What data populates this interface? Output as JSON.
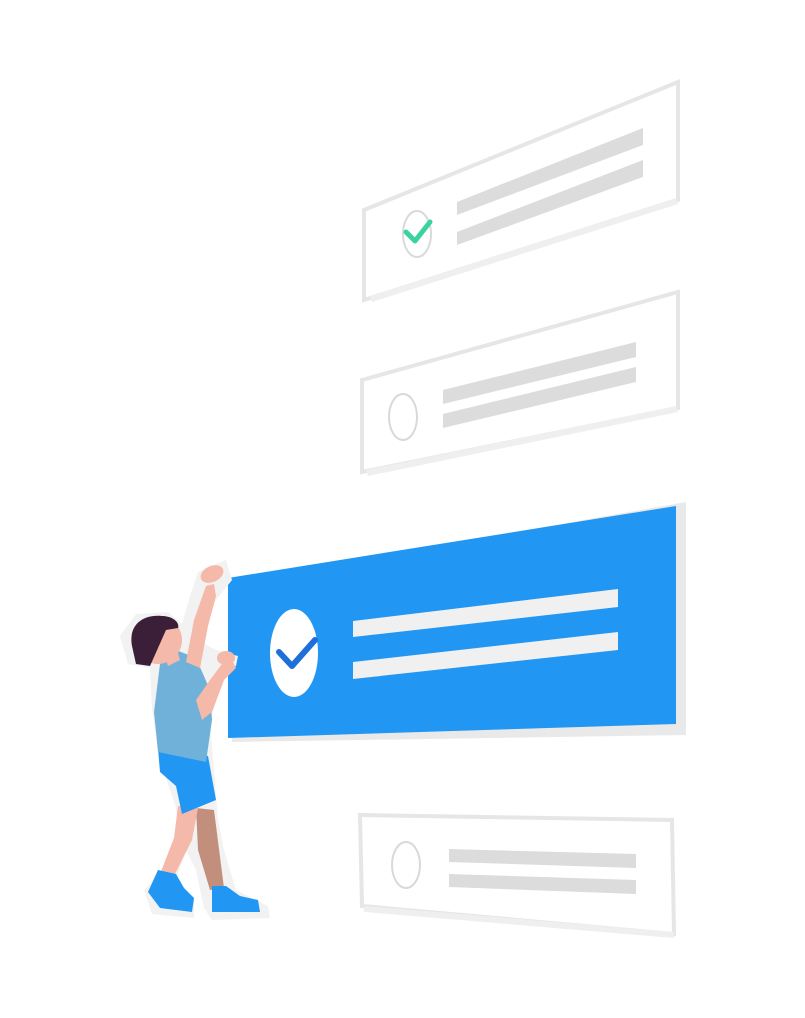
{
  "colors": {
    "background": "#ffffff",
    "card_outline": "#e6e6e6",
    "card_fill": "#ffffff",
    "line_gray": "#dcdcdc",
    "radio_gray": "#d9d9d9",
    "check_green": "#3ad29f",
    "accent_blue": "#2196f3",
    "check_blue": "#1e6fd8",
    "line_white": "#f2f2f2",
    "skin": "#f4b9a8",
    "skin_shadow": "#c28f7d",
    "hair": "#3b1f38",
    "shirt": "#6fb1d8",
    "shorts": "#2196f3",
    "shoes": "#2196f3",
    "figure_outline": "#ebebeb"
  },
  "options": [
    {
      "state": "checked",
      "highlighted": false,
      "check_icon": "check-icon",
      "check_color": "green"
    },
    {
      "state": "unchecked",
      "highlighted": false,
      "check_icon": "empty-radio-icon"
    },
    {
      "state": "checked",
      "highlighted": true,
      "check_icon": "check-icon",
      "check_color": "blue"
    },
    {
      "state": "unchecked",
      "highlighted": false,
      "check_icon": "empty-radio-icon"
    }
  ]
}
